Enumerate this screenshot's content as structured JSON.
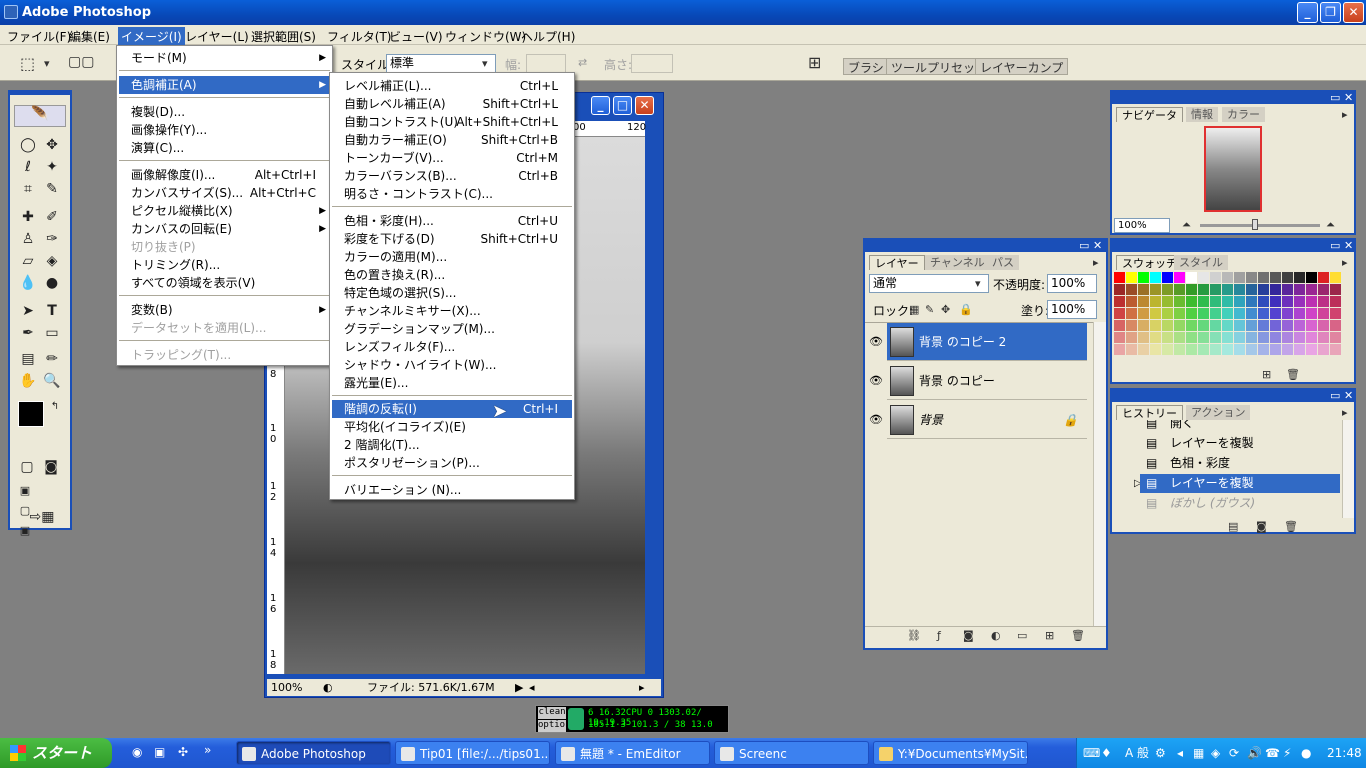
{
  "window": {
    "title": "Adobe Photoshop"
  },
  "menubar": [
    "ファイル(F)",
    "編集(E)",
    "イメージ(I)",
    "レイヤー(L)",
    "選択範囲(S)",
    "フィルタ(T)",
    "ビュー(V)",
    "ウィンドウ(W)",
    "ヘルプ(H)"
  ],
  "options": {
    "style_label": "スタイル:",
    "style_value": "標準",
    "width_label": "幅:",
    "height_label": "高さ:",
    "tabs": [
      "ブラシ",
      "ツールプリセット",
      "レイヤーカンプ"
    ]
  },
  "image_menu": {
    "items": [
      {
        "label": "モード(M)",
        "sc": "",
        "sub": true
      },
      {
        "label": "色調補正(A)",
        "sc": "",
        "sub": true
      },
      {
        "label": "複製(D)...",
        "sc": ""
      },
      {
        "label": "画像操作(Y)...",
        "sc": ""
      },
      {
        "label": "演算(C)...",
        "sc": ""
      },
      {
        "label": "画像解像度(I)...",
        "sc": "Alt+Ctrl+I"
      },
      {
        "label": "カンバスサイズ(S)...",
        "sc": "Alt+Ctrl+C"
      },
      {
        "label": "ピクセル縦横比(X)",
        "sc": "",
        "sub": true
      },
      {
        "label": "カンバスの回転(E)",
        "sc": "",
        "sub": true
      },
      {
        "label": "切り抜き(P)",
        "sc": ""
      },
      {
        "label": "トリミング(R)...",
        "sc": ""
      },
      {
        "label": "すべての領域を表示(V)",
        "sc": ""
      },
      {
        "label": "変数(B)",
        "sc": "",
        "sub": true
      },
      {
        "label": "データセットを適用(L)...",
        "sc": ""
      },
      {
        "label": "トラッピング(T)...",
        "sc": ""
      }
    ]
  },
  "adjust_menu": {
    "items": [
      {
        "label": "レベル補正(L)...",
        "sc": "Ctrl+L"
      },
      {
        "label": "自動レベル補正(A)",
        "sc": "Shift+Ctrl+L"
      },
      {
        "label": "自動コントラスト(U)",
        "sc": "Alt+Shift+Ctrl+L"
      },
      {
        "label": "自動カラー補正(O)",
        "sc": "Shift+Ctrl+B"
      },
      {
        "label": "トーンカーブ(V)...",
        "sc": "Ctrl+M"
      },
      {
        "label": "カラーバランス(B)...",
        "sc": "Ctrl+B"
      },
      {
        "label": "明るさ・コントラスト(C)...",
        "sc": ""
      },
      {
        "label": "色相・彩度(H)...",
        "sc": "Ctrl+U"
      },
      {
        "label": "彩度を下げる(D)",
        "sc": "Shift+Ctrl+U"
      },
      {
        "label": "カラーの適用(M)...",
        "sc": ""
      },
      {
        "label": "色の置き換え(R)...",
        "sc": ""
      },
      {
        "label": "特定色域の選択(S)...",
        "sc": ""
      },
      {
        "label": "チャンネルミキサー(X)...",
        "sc": ""
      },
      {
        "label": "グラデーションマップ(M)...",
        "sc": ""
      },
      {
        "label": "レンズフィルタ(F)...",
        "sc": ""
      },
      {
        "label": "シャドウ・ハイライト(W)...",
        "sc": ""
      },
      {
        "label": "露光量(E)...",
        "sc": ""
      },
      {
        "label": "階調の反転(I)",
        "sc": "Ctrl+I"
      },
      {
        "label": "平均化(イコライズ)(E)",
        "sc": ""
      },
      {
        "label": "2 階調化(T)...",
        "sc": ""
      },
      {
        "label": "ポスタリゼーション(P)...",
        "sc": ""
      },
      {
        "label": "バリエーション (N)...",
        "sc": ""
      }
    ]
  },
  "document": {
    "zoom": "100%",
    "file_info": "ファイル: 571.6K/1.67M",
    "ruler_top": [
      "00",
      "120"
    ],
    "ruler_left": [
      "8",
      "1 0",
      "1 2",
      "1 4",
      "1 6",
      "1 8"
    ]
  },
  "navigator": {
    "tabs": [
      "ナビゲータ",
      "情報",
      "カラー"
    ],
    "zoom": "100%"
  },
  "swatches": {
    "tabs": [
      "スウォッチ",
      "スタイル"
    ]
  },
  "layers": {
    "tabs": [
      "レイヤー",
      "チャンネル",
      "パス"
    ],
    "blend": "通常",
    "opacity_label": "不透明度:",
    "opacity": "100%",
    "lock_label": "ロック:",
    "fill_label": "塗り:",
    "fill": "100%",
    "items": [
      {
        "name": "背景 のコピー 2",
        "selected": true
      },
      {
        "name": "背景 のコピー",
        "selected": false
      },
      {
        "name": "背景",
        "selected": false
      }
    ]
  },
  "history": {
    "tabs": [
      "ヒストリー",
      "アクション"
    ],
    "items": [
      {
        "label": "開く"
      },
      {
        "label": "レイヤーを複製"
      },
      {
        "label": "色相・彩度"
      },
      {
        "label": "レイヤーを複製",
        "selected": true
      },
      {
        "label": "ぼかし (ガウス)",
        "disabled": true
      }
    ]
  },
  "cpu_meter": {
    "btn1": "clean",
    "btn2": "option",
    "line1": "6 16.32CPU  0 1303.02/ 19.19.35",
    "line2": "105.1         3 101.3 / 38 13.0"
  },
  "taskbar": {
    "start": "スタート",
    "tasks": [
      "Adobe Photoshop",
      "Tip01 [file:/.../tips01...",
      "無題 * - EmEditor",
      "Screenc",
      "Y:¥Documents¥MySit..."
    ],
    "tray_ime": "A 般",
    "clock": "21:48"
  },
  "colors": {
    "titlebar": "#0a5fd8",
    "highlight": "#316ac5",
    "panel": "#ece9d8"
  }
}
